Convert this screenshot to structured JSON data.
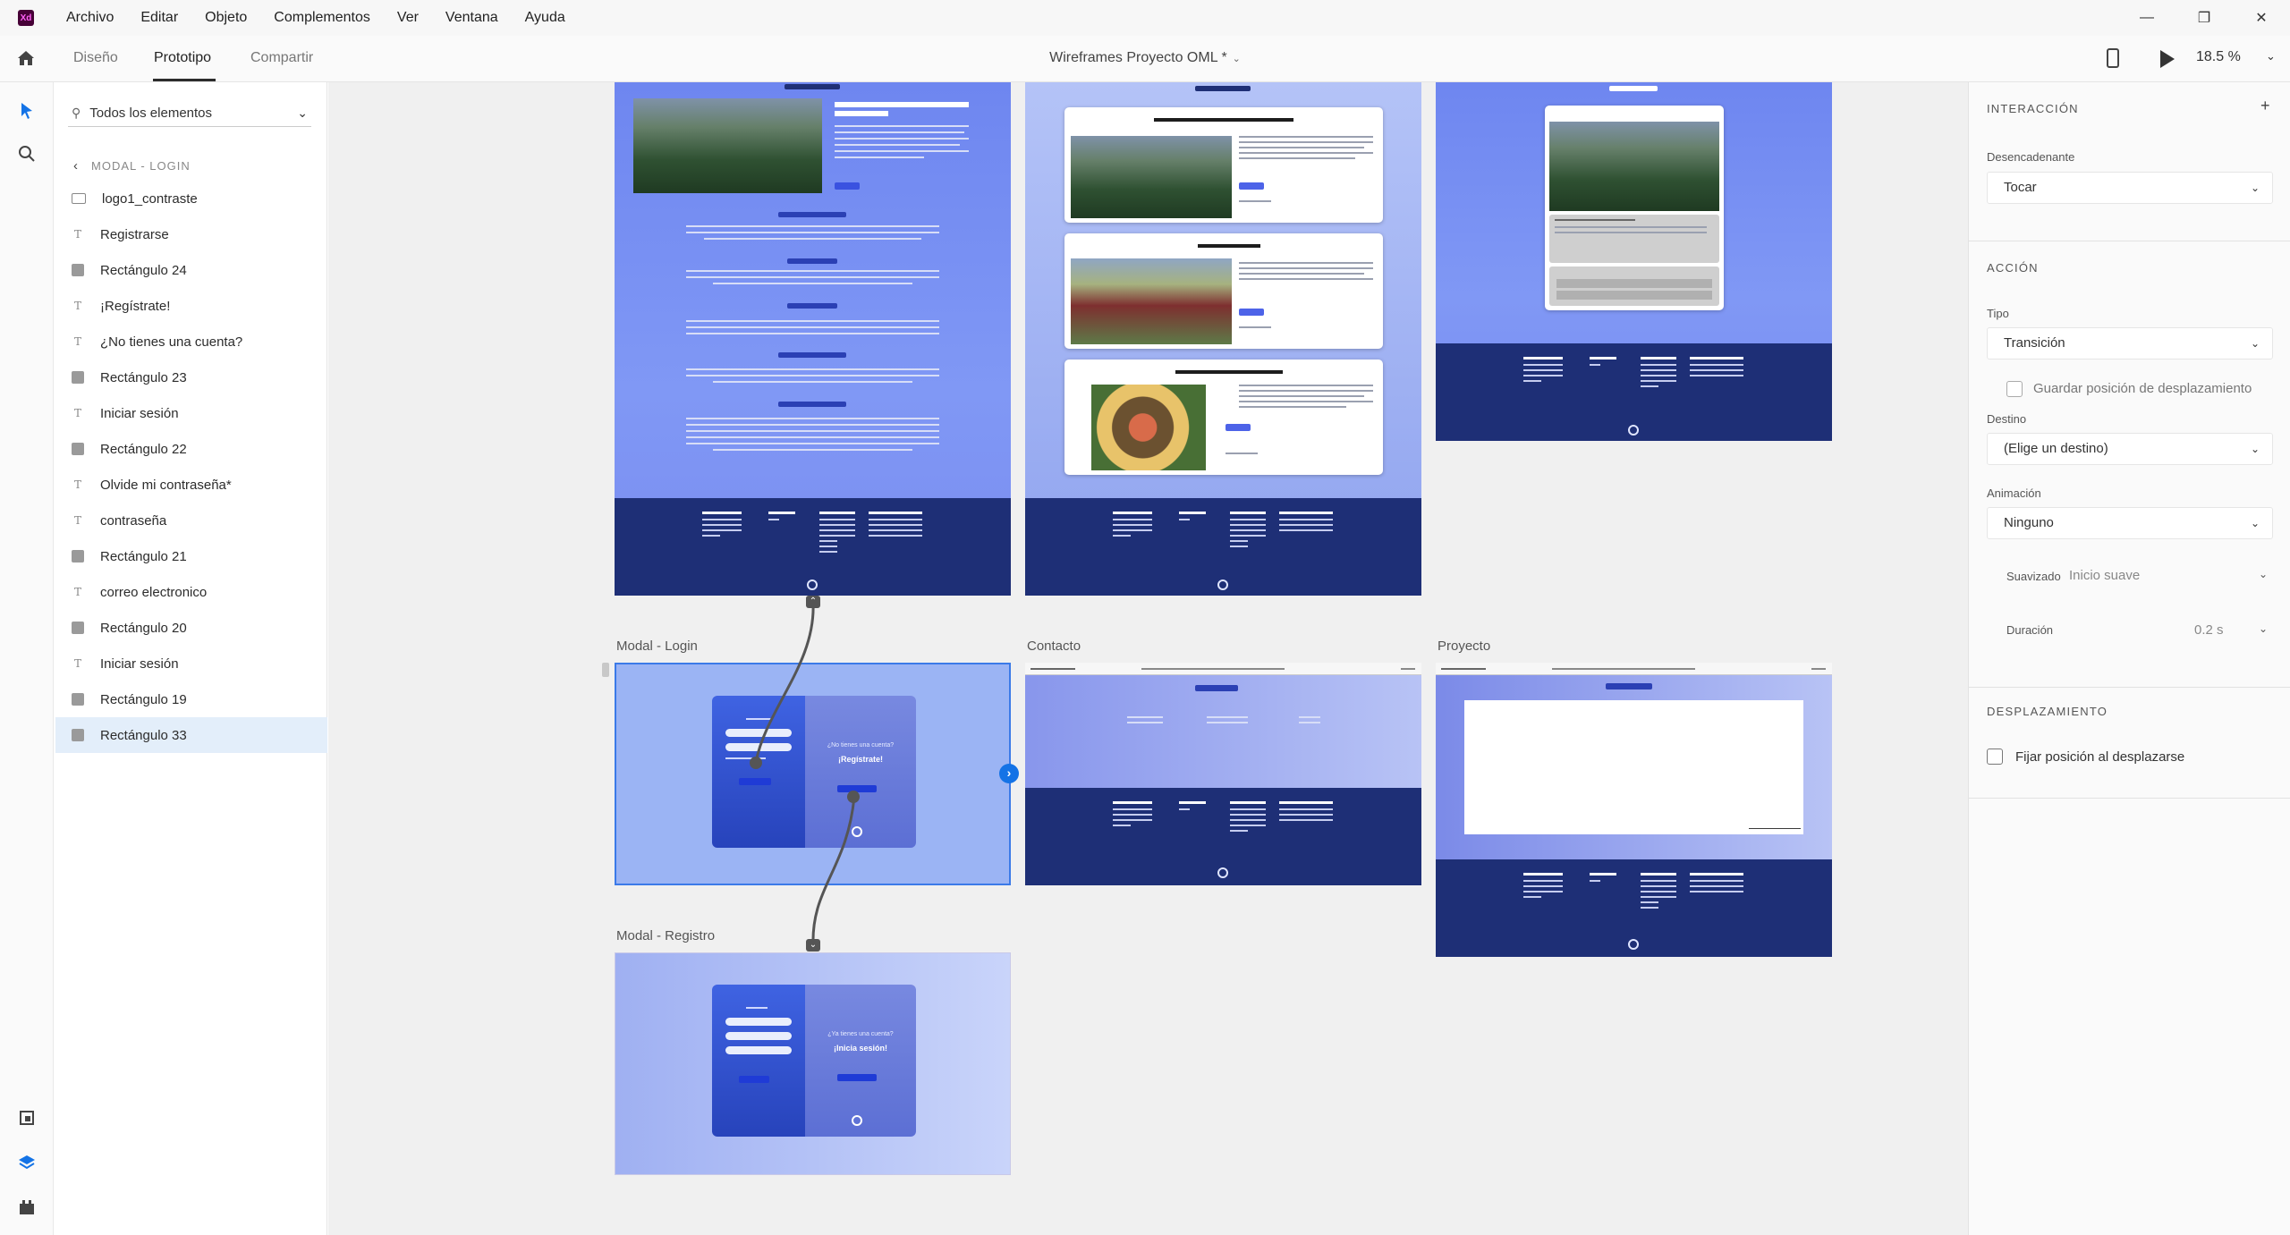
{
  "app": {
    "logo_text": "Xd",
    "colors": {
      "accent": "#1473e6",
      "logo_bg": "#470137",
      "logo_fg": "#ff61f6"
    }
  },
  "menu": [
    "Archivo",
    "Editar",
    "Objeto",
    "Complementos",
    "Ver",
    "Ventana",
    "Ayuda"
  ],
  "window_controls": {
    "minimize": "—",
    "restore": "❐",
    "close": "✕"
  },
  "toolbar": {
    "tabs": [
      "Diseño",
      "Prototipo",
      "Compartir"
    ],
    "active_tab": "Prototipo",
    "doc_title": "Wireframes Proyecto OML *",
    "zoom": "18.5 %"
  },
  "layers": {
    "filter": "Todos los elementos",
    "back_label": "MODAL - LOGIN",
    "items": [
      {
        "label": "logo1_contraste",
        "icon": "image-icon"
      },
      {
        "label": "Registrarse",
        "icon": "text-icon"
      },
      {
        "label": "Rectángulo 24",
        "icon": "rectangle-icon"
      },
      {
        "label": "¡Regístrate!",
        "icon": "text-icon"
      },
      {
        "label": "¿No tienes una cuenta?",
        "icon": "text-icon"
      },
      {
        "label": "Rectángulo 23",
        "icon": "rectangle-icon"
      },
      {
        "label": "Iniciar sesión",
        "icon": "text-icon"
      },
      {
        "label": "Rectángulo 22",
        "icon": "rectangle-icon"
      },
      {
        "label": "Olvide mi contraseña*",
        "icon": "text-icon"
      },
      {
        "label": "contraseña",
        "icon": "text-icon"
      },
      {
        "label": "Rectángulo 21",
        "icon": "rectangle-icon"
      },
      {
        "label": "correo electronico",
        "icon": "text-icon"
      },
      {
        "label": "Rectángulo 20",
        "icon": "rectangle-icon"
      },
      {
        "label": "Iniciar sesión",
        "icon": "text-icon"
      },
      {
        "label": "Rectángulo 19",
        "icon": "rectangle-icon"
      },
      {
        "label": "Rectángulo 33",
        "icon": "rectangle-icon",
        "selected": true
      }
    ]
  },
  "canvas": {
    "artboards": {
      "modal_login": "Modal - Login",
      "modal_registro": "Modal - Registro",
      "contacto": "Contacto",
      "proyecto": "Proyecto"
    },
    "org_page": {
      "heading": "CENTRO MEXICANO DE DERECHO AMBIENTAL"
    },
    "cards": [
      "CENTRO MEXICANO DE DERECHO AMBIENTAL",
      "PRONATURA MÉXICO",
      "FUNDACION QUINTA CARMELITA"
    ],
    "login_modal": {
      "question": "¿No tienes una cuenta?",
      "cta": "¡Regístrate!"
    },
    "register_modal": {
      "question": "¿Ya tienes una cuenta?",
      "cta": "¡Inicia sesión!"
    }
  },
  "inspector": {
    "interaction_title": "INTERACCIÓN",
    "trigger_label": "Desencadenante",
    "trigger_value": "Tocar",
    "action_title": "ACCIÓN",
    "type_label": "Tipo",
    "type_value": "Transición",
    "preserve_scroll_label": "Guardar posición de desplazamiento",
    "destination_label": "Destino",
    "destination_value": "(Elige un destino)",
    "animation_label": "Animación",
    "animation_value": "Ninguno",
    "easing_label": "Suavizado",
    "easing_value": "Inicio suave",
    "duration_label": "Duración",
    "duration_value": "0.2 s",
    "scroll_title": "DESPLAZAMIENTO",
    "fix_position_label": "Fijar posición al desplazarse"
  }
}
